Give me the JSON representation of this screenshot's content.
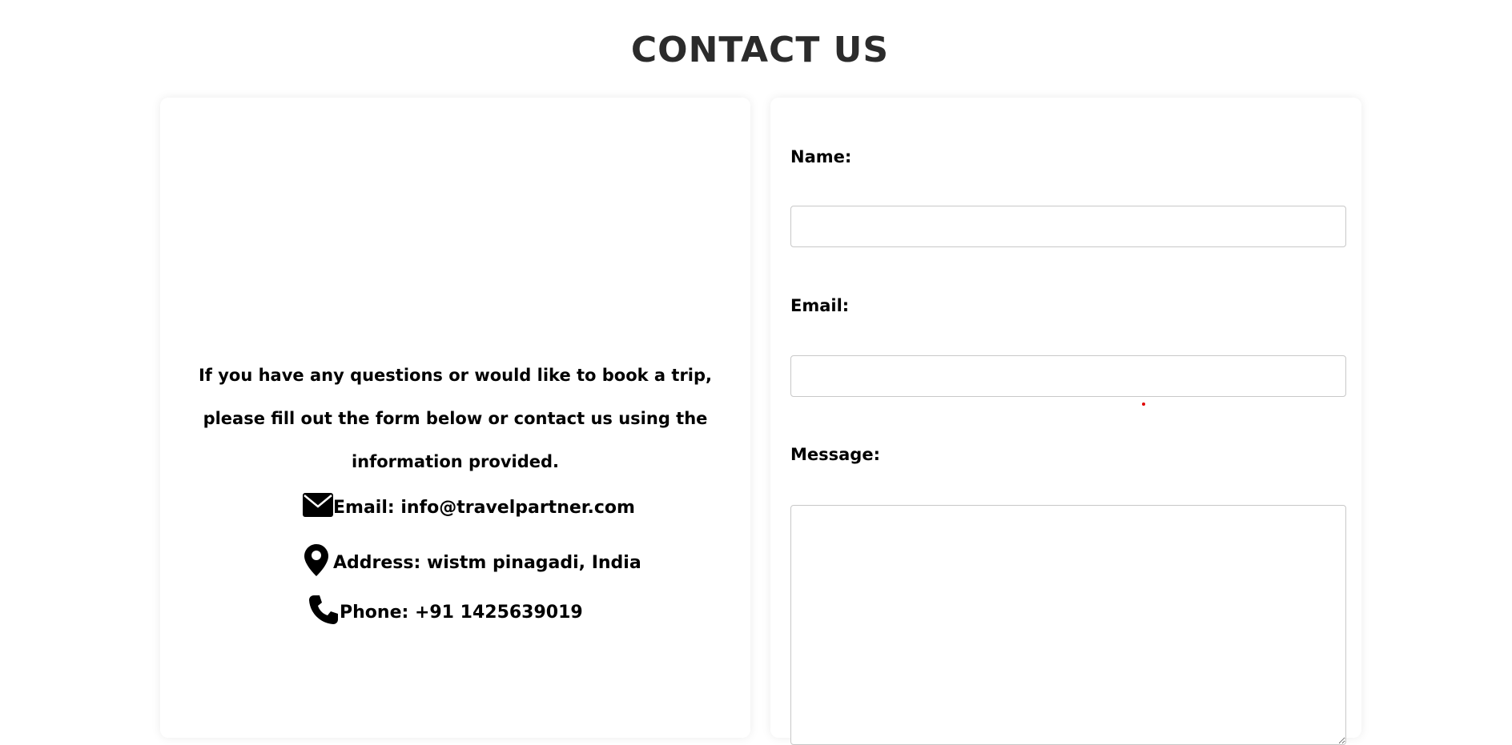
{
  "page": {
    "title": "CONTACT US"
  },
  "info": {
    "intro": "If you have any questions or would like to book a trip, please fill out the form below or contact us using the information provided.",
    "email_text": "Email: info@travelpartner.com",
    "address_text": "Address: wistm pinagadi, India",
    "phone_text": "Phone: +91 1425639019",
    "icons": {
      "email": "envelope-icon",
      "address": "map-pin-icon",
      "phone": "phone-icon"
    }
  },
  "form": {
    "name_label": "Name:",
    "name_value": "",
    "email_label": "Email:",
    "email_value": "",
    "message_label": "Message:",
    "message_value": ""
  },
  "colors": {
    "title": "#2b2b2b",
    "text": "#000000",
    "field_border": "#c8c8c8",
    "accent_dot": "#e00000"
  }
}
